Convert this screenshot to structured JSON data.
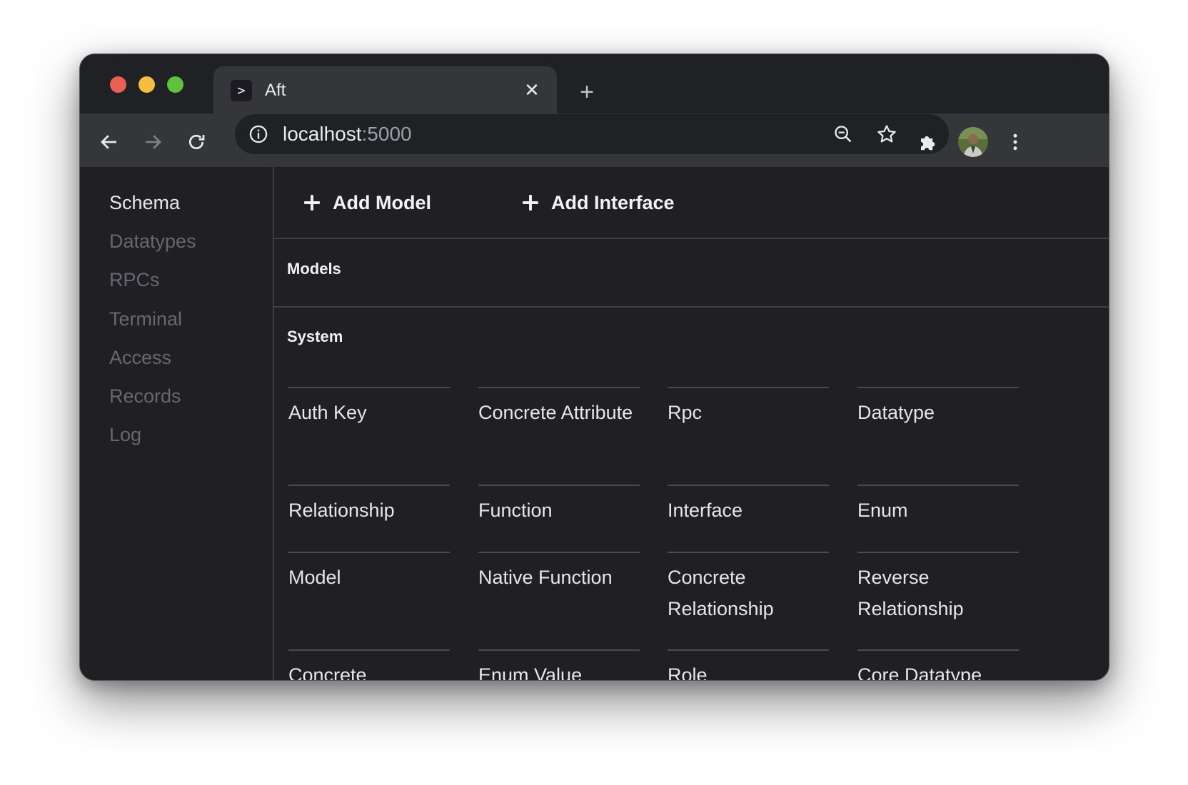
{
  "browser": {
    "tab": {
      "favicon_glyph": ">",
      "title": "Aft",
      "close_glyph": "✕"
    },
    "new_tab_glyph": "+",
    "address": {
      "host": "localhost",
      "port": ":5000"
    },
    "icons": {
      "back": "arrow-left-icon",
      "forward": "arrow-right-icon",
      "reload": "reload-icon",
      "site_info": "info-icon",
      "zoom": "zoom-out-icon",
      "bookmark": "star-icon",
      "extensions": "puzzle-icon",
      "profile": "avatar",
      "menu": "kebab-menu-icon"
    },
    "traffic_lights": {
      "red": "#ec5f57",
      "yellow": "#f6bd3f",
      "green": "#5ec23f"
    }
  },
  "sidebar": {
    "items": [
      {
        "label": "Schema",
        "active": true
      },
      {
        "label": "Datatypes",
        "active": false
      },
      {
        "label": "RPCs",
        "active": false
      },
      {
        "label": "Terminal",
        "active": false
      },
      {
        "label": "Access",
        "active": false
      },
      {
        "label": "Records",
        "active": false
      },
      {
        "label": "Log",
        "active": false
      }
    ]
  },
  "toolbar": {
    "add_model_label": "Add Model",
    "add_interface_label": "Add Interface"
  },
  "sections": {
    "models_title": "Models",
    "system_title": "System"
  },
  "system_models": [
    "Auth Key",
    "Concrete Attribute",
    "Rpc",
    "Datatype",
    "Relationship",
    "Function",
    "Interface",
    "Enum",
    "Model",
    "Native Function",
    "Concrete Relationship",
    "Reverse Relationship",
    "Concrete",
    "Enum Value",
    "Role",
    "Core Datatype"
  ],
  "colors": {
    "background": "#202024",
    "active_nav": "#e7e7ea",
    "inactive_nav": "#67676f"
  }
}
